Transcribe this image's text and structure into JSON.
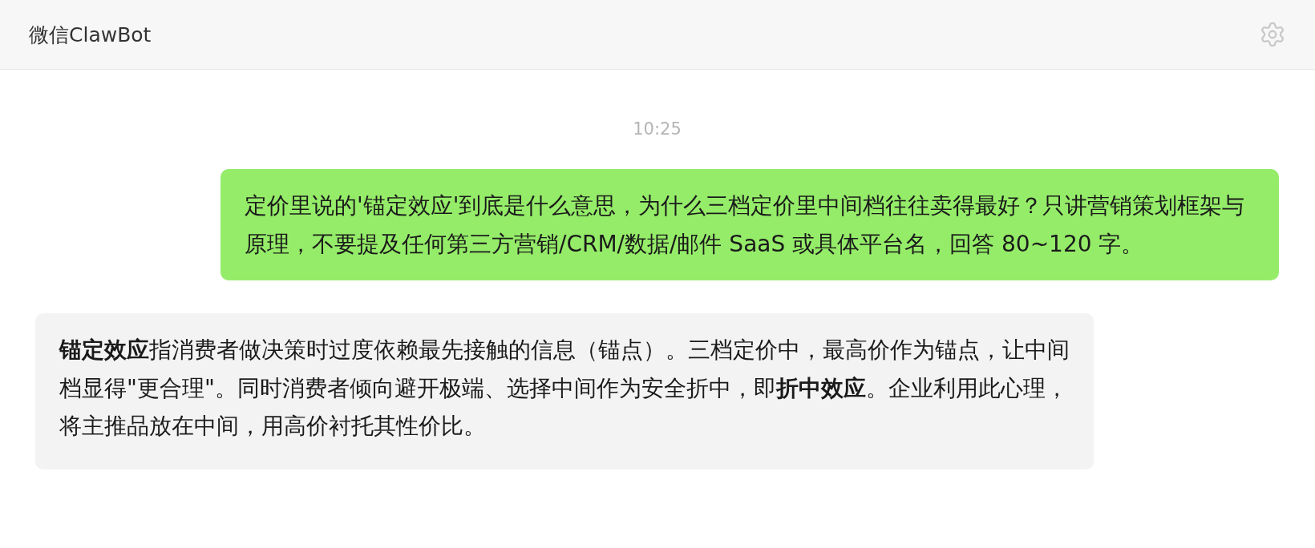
{
  "header": {
    "title": "微信ClawBot"
  },
  "messages": [
    {
      "kind": "timestamp",
      "text": "10:25"
    },
    {
      "kind": "user",
      "text": "定价里说的'锚定效应'到底是什么意思，为什么三档定价里中间档往往卖得最好？只讲营销策划框架与原理，不要提及任何第三方营销/CRM/数据/邮件 SaaS 或具体平台名，回答 80~120 字。"
    },
    {
      "kind": "bot",
      "text": "**锚定效应**指消费者做决策时过度依赖最先接触的信息（锚点）。三档定价中，最高价作为锚点，让中间档显得\"更合理\"。同时消费者倾向避开极端、选择中间作为安全折中，即**折中效应**。企业利用此心理，将主推品放在中间，用高价衬托其性价比。"
    }
  ]
}
